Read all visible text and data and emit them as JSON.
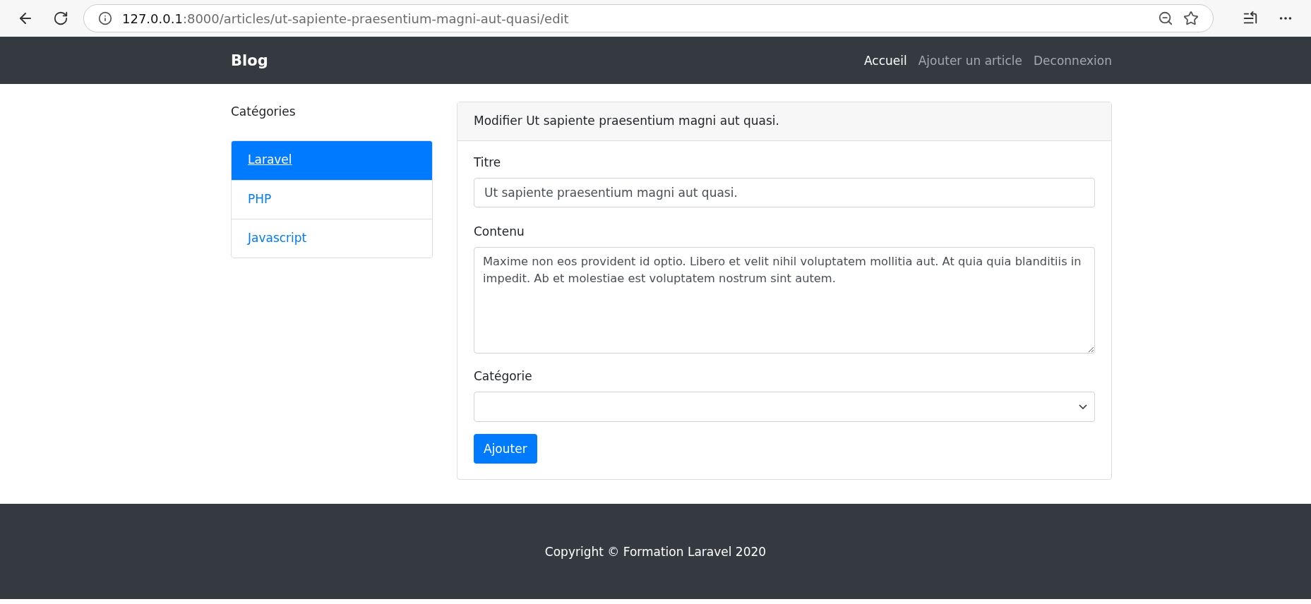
{
  "browser": {
    "url_host": "127.0.0.1",
    "url_path": ":8000/articles/ut-sapiente-praesentium-magni-aut-quasi/edit"
  },
  "navbar": {
    "brand": "Blog",
    "links": [
      {
        "label": "Accueil",
        "selected": true
      },
      {
        "label": "Ajouter un article",
        "selected": false
      },
      {
        "label": "Deconnexion",
        "selected": false
      }
    ]
  },
  "sidebar": {
    "title": "Catégories",
    "items": [
      {
        "label": "Laravel",
        "selected": true
      },
      {
        "label": "PHP",
        "selected": false
      },
      {
        "label": "Javascript",
        "selected": false
      }
    ]
  },
  "card": {
    "header": "Modifier Ut sapiente praesentium magni aut quasi.",
    "fields": [
      {
        "kind": "input",
        "label": "Titre",
        "value": "Ut sapiente praesentium magni aut quasi."
      },
      {
        "kind": "textarea",
        "label": "Contenu",
        "value": "Maxime non eos provident id optio. Libero et velit nihil voluptatem mollitia aut. At quia quia blanditiis in impedit. Ab et molestiae est voluptatem nostrum sint autem."
      },
      {
        "kind": "select",
        "label": "Catégorie"
      }
    ],
    "submit": "Ajouter"
  },
  "footer": {
    "text": "Copyright © Formation Laravel 2020"
  }
}
